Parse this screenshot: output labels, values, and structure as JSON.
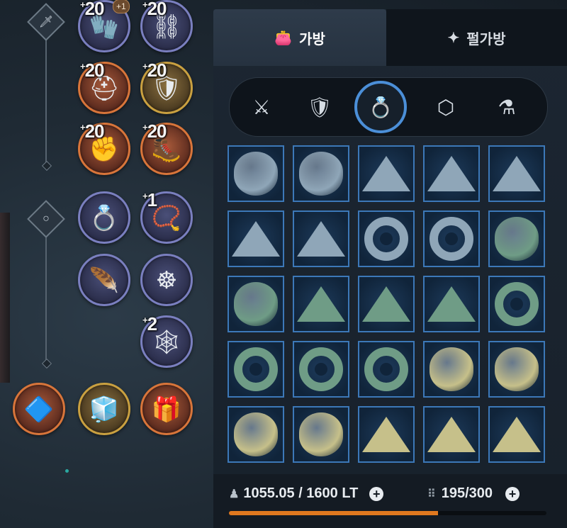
{
  "equipment": {
    "slots": [
      {
        "name": "gloves-slot",
        "enh": "20",
        "bonus": "+1",
        "art": "🧤",
        "style": "purple"
      },
      {
        "name": "belt-slot",
        "enh": "20",
        "bonus": "",
        "art": "⛓",
        "style": "purple"
      },
      {
        "name": "helmet-slot",
        "enh": "20",
        "bonus": "",
        "art": "⛑",
        "style": "orange"
      },
      {
        "name": "armor-slot",
        "enh": "20",
        "bonus": "",
        "art": "🛡",
        "style": "gold"
      },
      {
        "name": "gauntlet-slot",
        "enh": "20",
        "bonus": "",
        "art": "✊",
        "style": "orange"
      },
      {
        "name": "boots-slot",
        "enh": "20",
        "bonus": "",
        "art": "🥾",
        "style": "orange"
      },
      {
        "name": "ring-slot",
        "enh": "",
        "bonus": "",
        "art": "💍",
        "style": "purple"
      },
      {
        "name": "necklace-slot",
        "enh": "1",
        "bonus": "",
        "art": "📿",
        "style": "purple"
      },
      {
        "name": "earring-slot",
        "enh": "",
        "bonus": "",
        "art": "🪶",
        "style": "purple"
      },
      {
        "name": "brooch-slot",
        "enh": "",
        "bonus": "",
        "art": "☸",
        "style": "purple"
      },
      {
        "name": "belt-accessory-slot",
        "enh": "2",
        "bonus": "",
        "art": "🕸",
        "style": "purple"
      },
      {
        "name": "artifact-slot-1",
        "enh": "",
        "bonus": "",
        "art": "🔷",
        "style": "orange"
      },
      {
        "name": "artifact-slot-2",
        "enh": "",
        "bonus": "",
        "art": "🧊",
        "style": "gold"
      },
      {
        "name": "artifact-slot-3",
        "enh": "",
        "bonus": "",
        "art": "🎁",
        "style": "orange"
      }
    ]
  },
  "tabs": {
    "bag": "가방",
    "pearl_bag": "펄가방"
  },
  "filters": [
    {
      "name": "weapon-filter",
      "icon": "crossed-swords-icon",
      "glyph": "⚔"
    },
    {
      "name": "armor-filter",
      "icon": "armor-icon",
      "glyph": "🛡"
    },
    {
      "name": "accessory-filter",
      "icon": "ring-icon",
      "glyph": "💍",
      "active": true
    },
    {
      "name": "gem-filter",
      "icon": "crystal-icon",
      "glyph": "⬡"
    },
    {
      "name": "consumable-filter",
      "icon": "potion-icon",
      "glyph": "⚗"
    }
  ],
  "inventory_grid": [
    [
      "oval-blue",
      "oval-blue",
      "pyramid-blue",
      "pyramid-blue",
      "pyramid-blue"
    ],
    [
      "pyramid-blue",
      "pyramid-blue",
      "ring-blue",
      "ring-blue",
      "oval-green"
    ],
    [
      "oval-green",
      "pyramid-green",
      "pyramid-green",
      "pyramid-green",
      "ring-green"
    ],
    [
      "ring-green",
      "ring-green",
      "ring-green",
      "oval-yellow",
      "oval-yellow"
    ],
    [
      "oval-yellow",
      "oval-yellow",
      "pyramid-yellow",
      "pyramid-yellow",
      "pyramid-yellow"
    ]
  ],
  "colors": {
    "blue": "#8fa6b8",
    "green": "#6f9c86",
    "yellow": "#c6c08a",
    "accent": "#4b8fd8",
    "weight_bar": "#e0781f"
  },
  "footer": {
    "weight_text": "1055.05 / 1600 LT",
    "weight_fraction": 0.659,
    "slots_text": "195/300"
  }
}
